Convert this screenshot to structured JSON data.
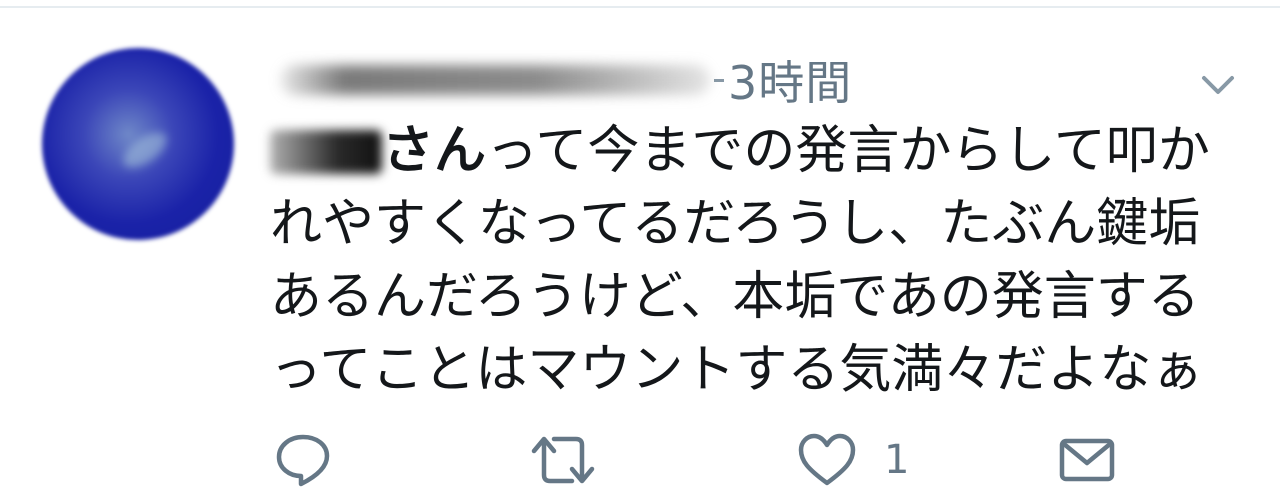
{
  "tweet": {
    "author_name": "",
    "timestamp": "3時間",
    "mention_suffix": "さん",
    "text_line1_rest": "って今までの発言からして叩か",
    "text_line2": "れやすくなってるだろうし、たぶん鍵垢",
    "text_line3": "あるんだろうけど、本垢であの発言する",
    "text_line4": "ってことはマウントする気満々だよなぁ"
  },
  "actions": {
    "reply": {
      "icon": "reply-icon"
    },
    "retweet": {
      "icon": "retweet-icon"
    },
    "like": {
      "icon": "heart-icon",
      "count": "1"
    },
    "dm": {
      "icon": "envelope-icon"
    }
  },
  "colors": {
    "text": "#14171a",
    "secondary": "#657786",
    "icon": "#657786",
    "divider": "#e6ecf0",
    "avatar": "#1a22a8"
  }
}
